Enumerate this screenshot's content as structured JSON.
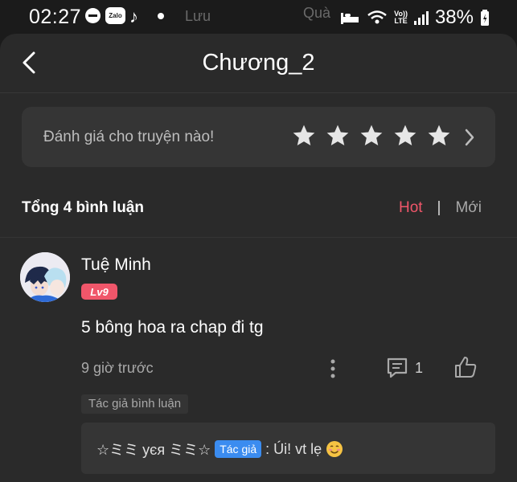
{
  "status_bar": {
    "time": "02:27",
    "zalo_label": "Zalo",
    "tiktok_glyph": "♪",
    "volte_top": "Vo))",
    "volte_bottom": "LTE",
    "battery": "38%",
    "icons": [
      "dnd-icon",
      "zalo-icon",
      "tiktok-icon",
      "dot-icon",
      "sleep-icon",
      "wifi-icon",
      "volte-icon",
      "signal-icon",
      "battery-icon"
    ]
  },
  "background_ghost": {
    "left_text": "Lưu",
    "middle_text": "Quà"
  },
  "header": {
    "title": "Chương_2"
  },
  "rating": {
    "prompt": "Đánh giá cho truyện nào!",
    "stars": 5
  },
  "comments_section": {
    "total": "Tổng 4 bình luận",
    "sort_hot": "Hot",
    "sort_separator": "|",
    "sort_new": "Mới",
    "accent": "#f0566a"
  },
  "comment": {
    "username": "Tuệ Minh",
    "level": "Lv9",
    "text": "5 bông hoa ra chap đi tg",
    "time_ago": "9 giờ trước",
    "reply_count": "1",
    "author_reply_tag": "Tác giả bình luận",
    "reply": {
      "author": "☆ミミ yєя ミミ☆",
      "badge": "Tác giả",
      "badge_color": "#3b8cf0",
      "text": ": Úi! vt lẹ"
    }
  }
}
